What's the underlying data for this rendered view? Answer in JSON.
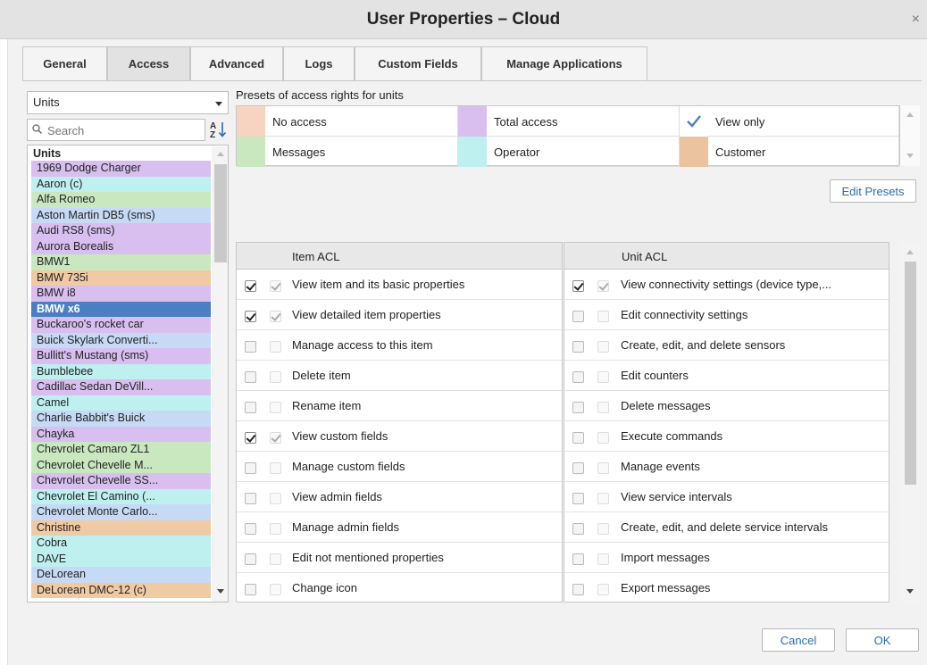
{
  "window": {
    "title": "User Properties – Cloud",
    "close_glyph": "×"
  },
  "tabs": [
    {
      "label": "General"
    },
    {
      "label": "Access",
      "active": true
    },
    {
      "label": "Advanced"
    },
    {
      "label": "Logs"
    },
    {
      "label": "Custom Fields"
    },
    {
      "label": "Manage Applications"
    }
  ],
  "left_panel": {
    "type_select": "Units",
    "search_placeholder": "Search",
    "sort_icon": "sort-az-icon",
    "list_header": "Units",
    "units": [
      {
        "name": "1969 Dodge Charger",
        "color": "#d8bff0"
      },
      {
        "name": "Aaron (c)",
        "color": "#bff0f0"
      },
      {
        "name": "Alfa Romeo",
        "color": "#c9e8c0"
      },
      {
        "name": "Aston Martin DB5 (sms)",
        "color": "#c6d9f5"
      },
      {
        "name": "Audi RS8 (sms)",
        "color": "#d8bff0"
      },
      {
        "name": "Aurora Borealis",
        "color": "#d8bff0"
      },
      {
        "name": "BMW1",
        "color": "#c9e8c0"
      },
      {
        "name": "BMW 735i",
        "color": "#f0caa3"
      },
      {
        "name": "BMW i8",
        "color": "#d8bff0"
      },
      {
        "name": "BMW x6",
        "color": "#4a7fc1",
        "selected": true
      },
      {
        "name": "Buckaroo's rocket car",
        "color": "#d8bff0"
      },
      {
        "name": "Buick Skylark Converti...",
        "color": "#c6d9f5"
      },
      {
        "name": "Bullitt's Mustang (sms)",
        "color": "#d8bff0"
      },
      {
        "name": "Bumblebee",
        "color": "#bff0f0"
      },
      {
        "name": "Cadillac Sedan DeVill...",
        "color": "#d8bff0"
      },
      {
        "name": "Camel",
        "color": "#bff0f0"
      },
      {
        "name": "Charlie Babbit's Buick",
        "color": "#c6d9f5"
      },
      {
        "name": "Chayka",
        "color": "#d8bff0"
      },
      {
        "name": "Chevrolet Camaro ZL1",
        "color": "#c9e8c0"
      },
      {
        "name": "Chevrolet Chevelle M...",
        "color": "#c9e8c0"
      },
      {
        "name": "Chevrolet Chevelle SS...",
        "color": "#d8bff0"
      },
      {
        "name": "Chevrolet El Camino (...",
        "color": "#bff0f0"
      },
      {
        "name": "Chevrolet Monte Carlo...",
        "color": "#c6d9f5"
      },
      {
        "name": "Christine",
        "color": "#f0caa3"
      },
      {
        "name": "Cobra",
        "color": "#bff0f0"
      },
      {
        "name": "DAVE",
        "color": "#bff0f0"
      },
      {
        "name": "DeLorean",
        "color": "#c6d9f5"
      },
      {
        "name": "DeLorean DMC-12 (c)",
        "color": "#f0caa3"
      }
    ]
  },
  "presets": {
    "label": "Presets of access rights for units",
    "items": [
      {
        "label": "No access",
        "color": "#f7d4c2",
        "checked": false
      },
      {
        "label": "Total access",
        "color": "#d8bff0",
        "checked": false
      },
      {
        "label": "View only",
        "color": "#ffffff",
        "checked": true,
        "icon": "check-icon"
      },
      {
        "label": "Messages",
        "color": "#c9e8c0",
        "checked": false
      },
      {
        "label": "Operator",
        "color": "#bff0f0",
        "checked": false
      },
      {
        "label": "Customer",
        "color": "#ebc49f",
        "checked": false
      }
    ],
    "edit_button": "Edit Presets"
  },
  "item_acl": {
    "header": "Item ACL",
    "rows": [
      {
        "label": "View item and its basic properties",
        "checked": true
      },
      {
        "label": "View detailed item properties",
        "checked": true
      },
      {
        "label": "Manage access to this item",
        "checked": false
      },
      {
        "label": "Delete item",
        "checked": false
      },
      {
        "label": "Rename item",
        "checked": false
      },
      {
        "label": "View custom fields",
        "checked": true
      },
      {
        "label": "Manage custom fields",
        "checked": false
      },
      {
        "label": "View admin fields",
        "checked": false
      },
      {
        "label": "Manage admin fields",
        "checked": false
      },
      {
        "label": "Edit not mentioned properties",
        "checked": false
      },
      {
        "label": "Change icon",
        "checked": false
      }
    ]
  },
  "unit_acl": {
    "header": "Unit ACL",
    "rows": [
      {
        "label": "View connectivity settings (device type,...",
        "checked": true
      },
      {
        "label": "Edit connectivity settings",
        "checked": false
      },
      {
        "label": "Create, edit, and delete sensors",
        "checked": false
      },
      {
        "label": "Edit counters",
        "checked": false
      },
      {
        "label": "Delete messages",
        "checked": false
      },
      {
        "label": "Execute commands",
        "checked": false
      },
      {
        "label": "Manage events",
        "checked": false
      },
      {
        "label": "View service intervals",
        "checked": false
      },
      {
        "label": "Create, edit, and delete service intervals",
        "checked": false
      },
      {
        "label": "Import messages",
        "checked": false
      },
      {
        "label": "Export messages",
        "checked": false
      }
    ]
  },
  "footer": {
    "cancel_label": "Cancel",
    "ok_label": "OK"
  }
}
